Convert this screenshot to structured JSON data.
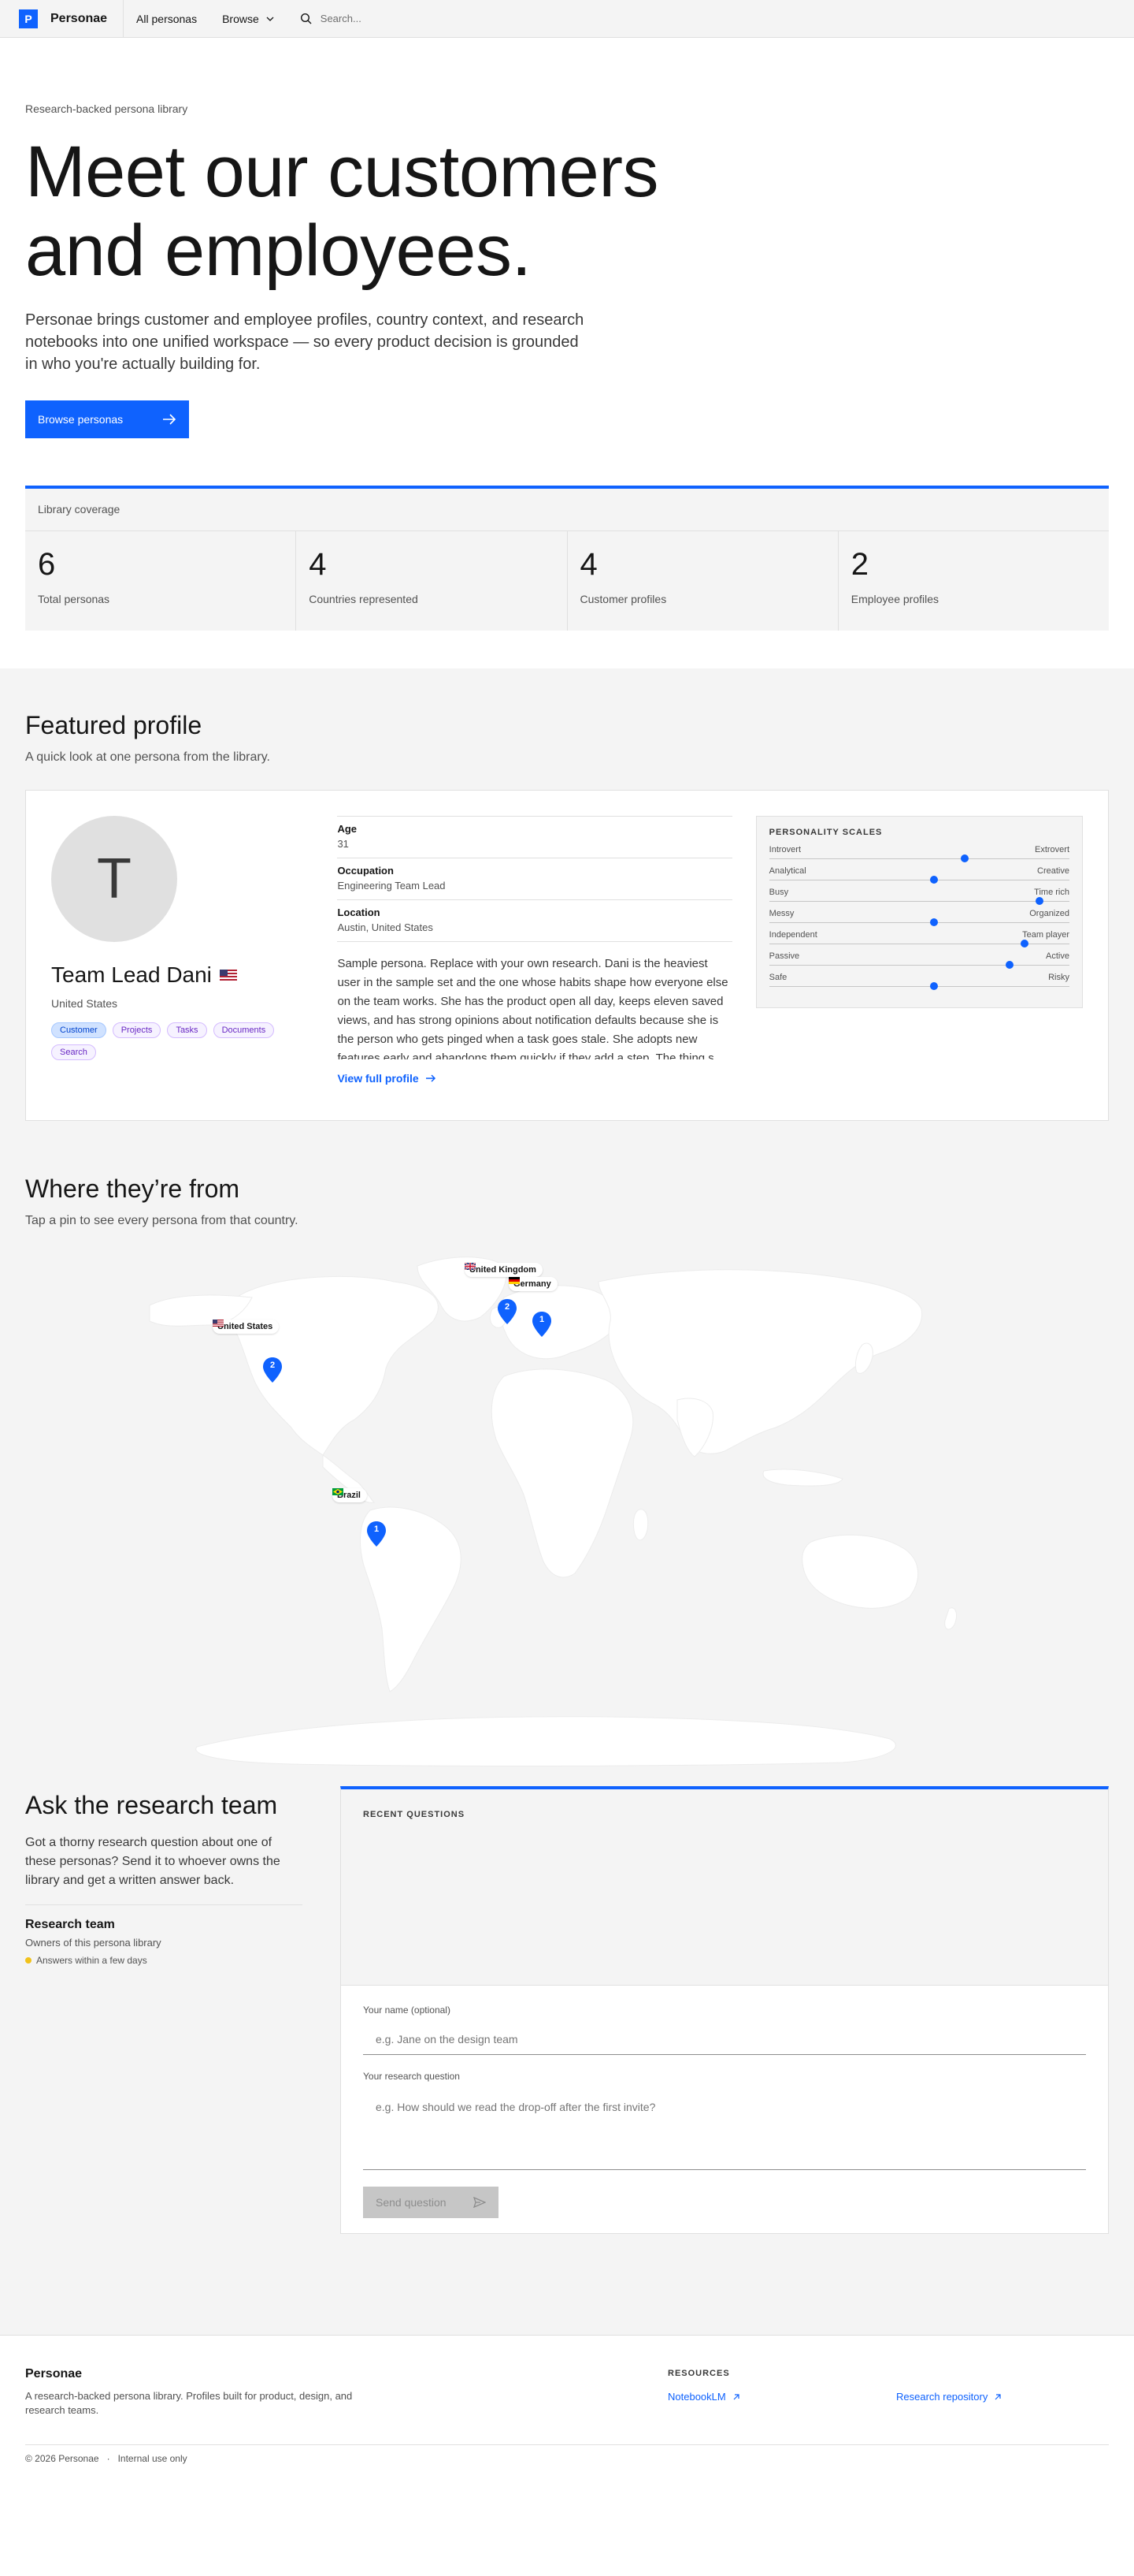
{
  "header": {
    "logo_letter": "P",
    "brand": "Personae",
    "nav": [
      "All personas",
      "Browse"
    ],
    "search_placeholder": "Search..."
  },
  "hero": {
    "eyebrow": "Research-backed persona library",
    "title_line1": "Meet our customers",
    "title_line2": "and employees.",
    "lead": "Personae brings customer and employee profiles, country context, and research notebooks into one unified workspace — so every product decision is grounded in who you're actually building for.",
    "cta": "Browse personas"
  },
  "coverage": {
    "label": "Library coverage",
    "stats": [
      {
        "value": "6",
        "label": "Total personas"
      },
      {
        "value": "4",
        "label": "Countries represented"
      },
      {
        "value": "4",
        "label": "Customer profiles"
      },
      {
        "value": "2",
        "label": "Employee profiles"
      }
    ]
  },
  "featured": {
    "title": "Featured profile",
    "subtitle": "A quick look at one persona from the library.",
    "avatar_letter": "T",
    "name": "Team Lead Dani",
    "country": "United States",
    "tags": [
      "Customer",
      "Projects",
      "Tasks",
      "Documents",
      "Search"
    ],
    "fields": [
      {
        "k": "Age",
        "v": "31"
      },
      {
        "k": "Occupation",
        "v": "Engineering Team Lead"
      },
      {
        "k": "Location",
        "v": "Austin, United States"
      }
    ],
    "bio": "Sample persona. Replace with your own research. Dani is the heaviest user in the sample set and the one whose habits shape how everyone else on the team works. She has the product open all day, keeps eleven saved views, and has strong opinions about notification defaults because she is the person who gets pinged when a task goes stale. She adopts new features early and abandons them quickly if they add a step. The thing s...",
    "link": "View full profile",
    "scales_title": "PERSONALITY SCALES",
    "scales": [
      {
        "left": "Introvert",
        "right": "Extrovert",
        "value": 0.65
      },
      {
        "left": "Analytical",
        "right": "Creative",
        "value": 0.55
      },
      {
        "left": "Busy",
        "right": "Time rich",
        "value": 0.9
      },
      {
        "left": "Messy",
        "right": "Organized",
        "value": 0.55
      },
      {
        "left": "Independent",
        "right": "Team player",
        "value": 0.85
      },
      {
        "left": "Passive",
        "right": "Active",
        "value": 0.8
      },
      {
        "left": "Safe",
        "right": "Risky",
        "value": 0.55
      }
    ]
  },
  "map": {
    "title": "Where they’re from",
    "subtitle": "Tap a pin to see every persona from that country.",
    "pins": [
      {
        "country": "United States",
        "count": "2"
      },
      {
        "country": "United Kingdom",
        "count": "2"
      },
      {
        "country": "Germany",
        "count": "1"
      },
      {
        "country": "Brazil",
        "count": "1"
      }
    ]
  },
  "ask": {
    "title": "Ask the research team",
    "text": "Got a thorny research question about one of these personas? Send it to whoever owns the library and get a written answer back.",
    "team": "Research team",
    "owners": "Owners of this persona library",
    "sla": "Answers within a few days",
    "recent_title": "RECENT QUESTIONS",
    "name_label": "Your name (optional)",
    "name_placeholder": "e.g. Jane on the design team",
    "question_label": "Your research question",
    "question_placeholder": "e.g. How should we read the drop-off after the first invite?",
    "send": "Send question"
  },
  "footer": {
    "brand": "Personae",
    "desc": "A research-backed persona library. Profiles built for product, design, and research teams.",
    "resources_title": "RESOURCES",
    "links": [
      "NotebookLM",
      "Research repository"
    ],
    "copyright": "© 2026 Personae",
    "note": "Internal use only"
  },
  "colors": {
    "accent": "#0f62fe",
    "gray_bg": "#f4f4f4",
    "sla_dot": "#f1c21b"
  }
}
